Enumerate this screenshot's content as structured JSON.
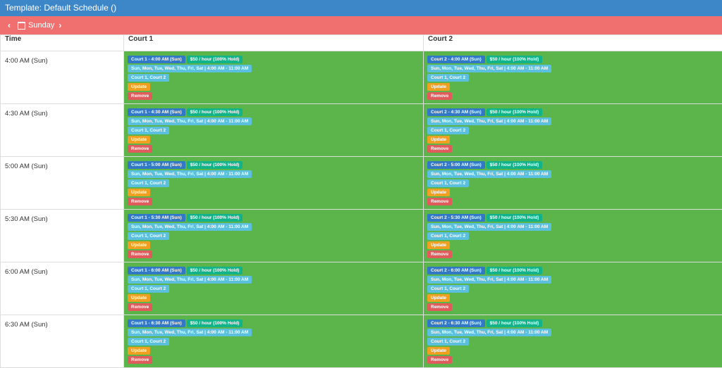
{
  "header": {
    "title": "Template: Default Schedule ()"
  },
  "daynav": {
    "prev": "‹",
    "day": "Sunday",
    "next": "›"
  },
  "table": {
    "columns": [
      "Time",
      "Court 1",
      "Court 2"
    ],
    "rows": [
      {
        "time": "4:00 AM (Sun)",
        "slots": [
          {
            "court": "Court 1 - 4:00 AM (Sun)",
            "price": "$50 / hour (100% Hold)",
            "days": "Sun, Mon, Tue, Wed, Thu, Fri, Sat | 4:00 AM - 11:00 AM",
            "courts": "Court 1, Court 2",
            "update": "Update",
            "remove": "Remove"
          },
          {
            "court": "Court 2 - 4:00 AM (Sun)",
            "price": "$50 / hour (100% Hold)",
            "days": "Sun, Mon, Tue, Wed, Thu, Fri, Sat | 4:00 AM - 11:00 AM",
            "courts": "Court 1, Court 2",
            "update": "Update",
            "remove": "Remove"
          }
        ]
      },
      {
        "time": "4:30 AM (Sun)",
        "slots": [
          {
            "court": "Court 1 - 4:30 AM (Sun)",
            "price": "$50 / hour (100% Hold)",
            "days": "Sun, Mon, Tue, Wed, Thu, Fri, Sat | 4:00 AM - 11:00 AM",
            "courts": "Court 1, Court 2",
            "update": "Update",
            "remove": "Remove"
          },
          {
            "court": "Court 2 - 4:30 AM (Sun)",
            "price": "$50 / hour (100% Hold)",
            "days": "Sun, Mon, Tue, Wed, Thu, Fri, Sat | 4:00 AM - 11:00 AM",
            "courts": "Court 1, Court 2",
            "update": "Update",
            "remove": "Remove"
          }
        ]
      },
      {
        "time": "5:00 AM (Sun)",
        "slots": [
          {
            "court": "Court 1 - 5:00 AM (Sun)",
            "price": "$50 / hour (100% Hold)",
            "days": "Sun, Mon, Tue, Wed, Thu, Fri, Sat | 4:00 AM - 11:00 AM",
            "courts": "Court 1, Court 2",
            "update": "Update",
            "remove": "Remove"
          },
          {
            "court": "Court 2 - 5:00 AM (Sun)",
            "price": "$50 / hour (100% Hold)",
            "days": "Sun, Mon, Tue, Wed, Thu, Fri, Sat | 4:00 AM - 11:00 AM",
            "courts": "Court 1, Court 2",
            "update": "Update",
            "remove": "Remove"
          }
        ]
      },
      {
        "time": "5:30 AM (Sun)",
        "slots": [
          {
            "court": "Court 1 - 5:30 AM (Sun)",
            "price": "$50 / hour (100% Hold)",
            "days": "Sun, Mon, Tue, Wed, Thu, Fri, Sat | 4:00 AM - 11:00 AM",
            "courts": "Court 1, Court 2",
            "update": "Update",
            "remove": "Remove"
          },
          {
            "court": "Court 2 - 5:30 AM (Sun)",
            "price": "$50 / hour (100% Hold)",
            "days": "Sun, Mon, Tue, Wed, Thu, Fri, Sat | 4:00 AM - 11:00 AM",
            "courts": "Court 1, Court 2",
            "update": "Update",
            "remove": "Remove"
          }
        ]
      },
      {
        "time": "6:00 AM (Sun)",
        "slots": [
          {
            "court": "Court 1 - 6:00 AM (Sun)",
            "price": "$50 / hour (100% Hold)",
            "days": "Sun, Mon, Tue, Wed, Thu, Fri, Sat | 4:00 AM - 11:00 AM",
            "courts": "Court 1, Court 2",
            "update": "Update",
            "remove": "Remove"
          },
          {
            "court": "Court 2 - 6:00 AM (Sun)",
            "price": "$50 / hour (100% Hold)",
            "days": "Sun, Mon, Tue, Wed, Thu, Fri, Sat | 4:00 AM - 11:00 AM",
            "courts": "Court 1, Court 2",
            "update": "Update",
            "remove": "Remove"
          }
        ]
      },
      {
        "time": "6:30 AM (Sun)",
        "slots": [
          {
            "court": "Court 1 - 6:30 AM (Sun)",
            "price": "$50 / hour (100% Hold)",
            "days": "Sun, Mon, Tue, Wed, Thu, Fri, Sat | 4:00 AM - 11:00 AM",
            "courts": "Court 1, Court 2",
            "update": "Update",
            "remove": "Remove"
          },
          {
            "court": "Court 2 - 6:30 AM (Sun)",
            "price": "$50 / hour (100% Hold)",
            "days": "Sun, Mon, Tue, Wed, Thu, Fri, Sat | 4:00 AM - 11:00 AM",
            "courts": "Court 1, Court 2",
            "update": "Update",
            "remove": "Remove"
          }
        ]
      }
    ]
  },
  "colors": {
    "header_bg": "#3d87c9",
    "daybar_bg": "#f07070",
    "slot_bg": "#5cb54a",
    "court_badge": "#3178c6",
    "price_badge": "#12b38a",
    "info_badge": "#5bc0de",
    "update_badge": "#f0a020",
    "remove_badge": "#e05c5c"
  }
}
